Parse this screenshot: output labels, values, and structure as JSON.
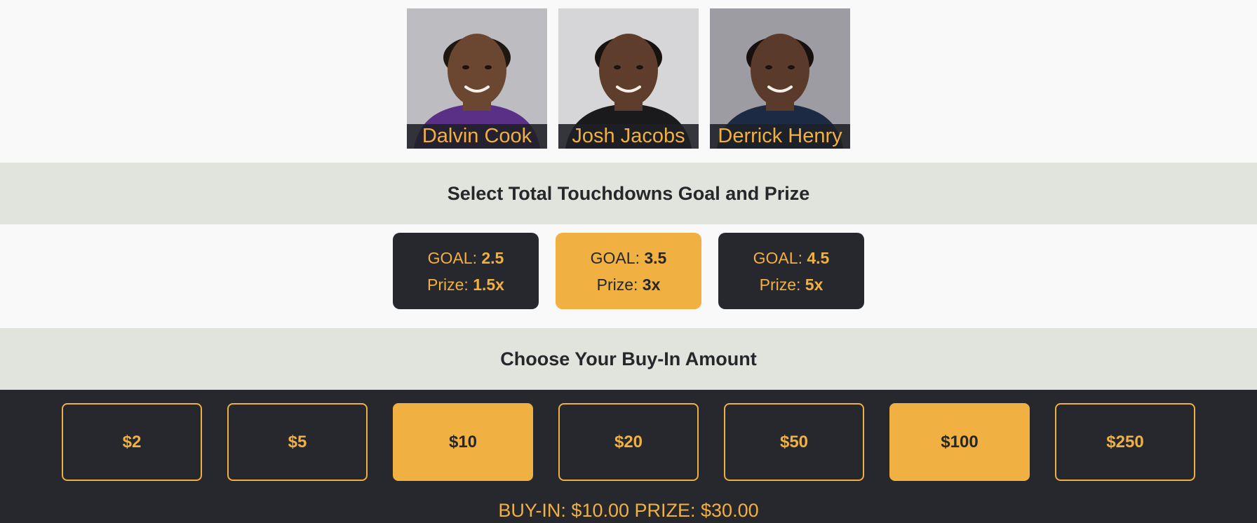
{
  "players": [
    {
      "name": "Dalvin Cook",
      "bg": "#bcbcc1",
      "skin": "#6b4631",
      "shirt": "#5a2f86",
      "hair": "#1f1712"
    },
    {
      "name": "Josh Jacobs",
      "bg": "#d6d6d8",
      "skin": "#5e3d2c",
      "shirt": "#1a1a1c",
      "hair": "#151210"
    },
    {
      "name": "Derrick Henry",
      "bg": "#9c9ca2",
      "skin": "#5a3b2b",
      "shirt": "#1c2a44",
      "hair": "#16110e"
    }
  ],
  "goal_section": {
    "title": "Select Total Touchdowns Goal and Prize"
  },
  "goals": [
    {
      "goal_label": "GOAL:",
      "goal_value": "2.5",
      "prize_label": "Prize:",
      "prize_value": "1.5x",
      "selected": false
    },
    {
      "goal_label": "GOAL:",
      "goal_value": "3.5",
      "prize_label": "Prize:",
      "prize_value": "3x",
      "selected": true
    },
    {
      "goal_label": "GOAL:",
      "goal_value": "4.5",
      "prize_label": "Prize:",
      "prize_value": "5x",
      "selected": false
    }
  ],
  "buyin_section": {
    "title": "Choose Your Buy-In Amount"
  },
  "amounts": [
    {
      "label": "$2",
      "selected": false
    },
    {
      "label": "$5",
      "selected": false
    },
    {
      "label": "$10",
      "selected": true
    },
    {
      "label": "$20",
      "selected": false
    },
    {
      "label": "$50",
      "selected": false
    },
    {
      "label": "$100",
      "selected": true
    },
    {
      "label": "$250",
      "selected": false
    }
  ],
  "summary": {
    "text": "BUY-IN: $10.00 PRIZE: $30.00"
  },
  "colors": {
    "accent": "#f0b042",
    "dark": "#26282d",
    "section_bg": "#e1e3dd",
    "page_bg": "#f9f9f9"
  }
}
